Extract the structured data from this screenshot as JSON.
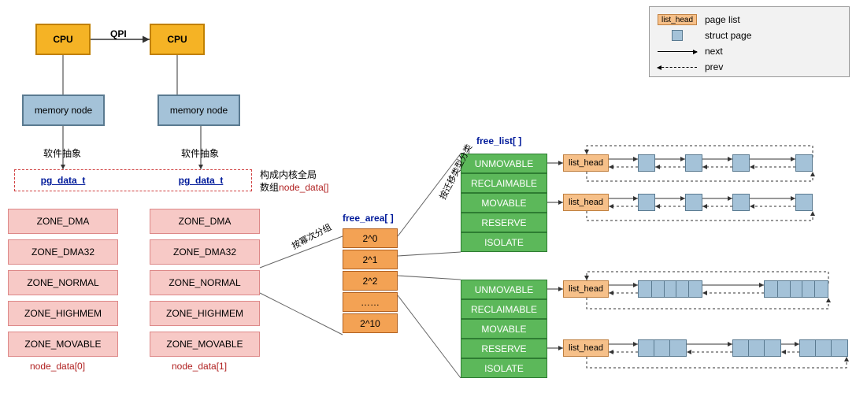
{
  "legend": {
    "list_head": "list_head",
    "page_list": "page list",
    "struct_page": "struct page",
    "next": "next",
    "prev": "prev"
  },
  "cpu": {
    "left": "CPU",
    "right": "CPU",
    "link": "QPI"
  },
  "memnode": {
    "left": "memory node",
    "right": "memory node"
  },
  "abstraction_label": "软件抽象",
  "pgdata": {
    "left": "pg_data_t",
    "right": "pg_data_t"
  },
  "node_data_text": {
    "line1": "构成内核全局",
    "line2": "数组",
    "array": "node_data[]"
  },
  "zones": [
    "ZONE_DMA",
    "ZONE_DMA32",
    "ZONE_NORMAL",
    "ZONE_HIGHMEM",
    "ZONE_MOVABLE"
  ],
  "node_labels": [
    "node_data[0]",
    "node_data[1]"
  ],
  "free_area": {
    "title": "free_area[ ]",
    "items": [
      "2^0",
      "2^1",
      "2^2",
      "……",
      "2^10"
    ],
    "group_label": "按幂次分组"
  },
  "free_list": {
    "title": "free_list[ ]",
    "items": [
      "UNMOVABLE",
      "RECLAIMABLE",
      "MOVABLE",
      "RESERVE",
      "ISOLATE"
    ],
    "classify_label": "按迁移类型分类"
  },
  "list_head_label": "list_head"
}
